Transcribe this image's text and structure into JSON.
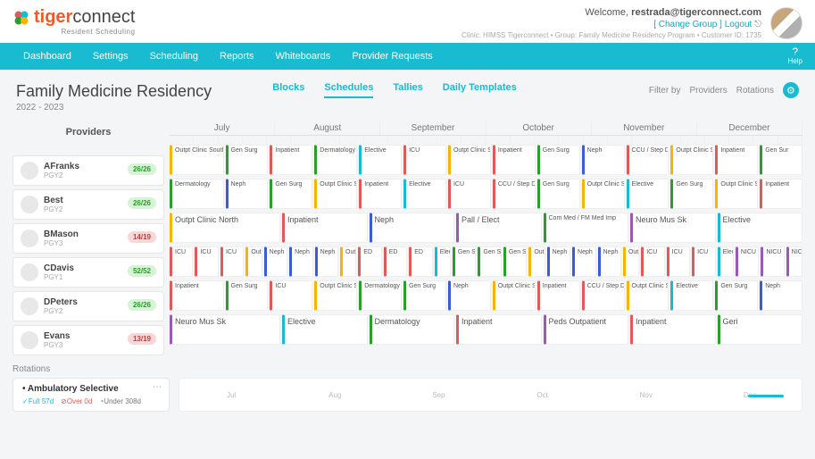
{
  "header": {
    "brand_tiger": "tiger",
    "brand_connect": "connect",
    "brand_sub": "Resident Scheduling",
    "welcome_prefix": "Welcome, ",
    "welcome_user": "restrada@tigerconnect.com",
    "link_change_group": "[ Change Group ]",
    "link_logout": "Logout",
    "meta": "Clinic: HIMSS Tigerconnect • Group: Family Medicine Residency Program • Customer ID: 1735"
  },
  "nav": {
    "items": [
      "Dashboard",
      "Settings",
      "Scheduling",
      "Reports",
      "Whiteboards",
      "Provider Requests"
    ],
    "help": "Help"
  },
  "title": {
    "main": "Family Medicine Residency",
    "sub": "2022 - 2023"
  },
  "tabs": [
    "Blocks",
    "Schedules",
    "Tallies",
    "Daily Templates"
  ],
  "filter": {
    "label": "Filter by",
    "providers": "Providers",
    "rotations": "Rotations"
  },
  "providers_header": "Providers",
  "months": [
    "July",
    "August",
    "September",
    "October",
    "November",
    "December"
  ],
  "providers": [
    {
      "name": "AFranks",
      "level": "PGY2",
      "badge": "26/26",
      "badgeClass": "green",
      "blocks": [
        {
          "w": 4,
          "c": "#f7b500",
          "t": "Outpt Clinic South"
        },
        {
          "w": 3,
          "c": "#2a9d2a",
          "t": "Gen Surg"
        },
        {
          "w": 3,
          "c": "#e05a5a",
          "t": "Inpatient"
        },
        {
          "w": 3,
          "c": "#2a9d2a",
          "t": "Dermatology"
        },
        {
          "w": 3,
          "c": "#18bbcf",
          "t": "Elective"
        },
        {
          "w": 3,
          "c": "#e05a5a",
          "t": "ICU"
        },
        {
          "w": 3,
          "c": "#f7b500",
          "t": "Outpt Clinic South"
        },
        {
          "w": 3,
          "c": "#e05a5a",
          "t": "Inpatient"
        },
        {
          "w": 3,
          "c": "#2a9d2a",
          "t": "Gen Surg"
        },
        {
          "w": 3,
          "c": "#3b5bdb",
          "t": "Neph"
        },
        {
          "w": 3,
          "c": "#e05a5a",
          "t": "CCU / Step Down"
        },
        {
          "w": 3,
          "c": "#f7b500",
          "t": "Outpt Clinic South"
        },
        {
          "w": 3,
          "c": "#e05a5a",
          "t": "Inpatient"
        },
        {
          "w": 3,
          "c": "#2a9d2a",
          "t": "Gen Sur"
        }
      ]
    },
    {
      "name": "Best",
      "level": "PGY2",
      "badge": "26/26",
      "badgeClass": "green",
      "blocks": [
        {
          "w": 4,
          "c": "#2a9d2a",
          "t": "Dermatology"
        },
        {
          "w": 3,
          "c": "#3b5bdb",
          "t": "Neph"
        },
        {
          "w": 3,
          "c": "#2a9d2a",
          "t": "Gen Surg"
        },
        {
          "w": 3,
          "c": "#f7b500",
          "t": "Outpt Clinic South"
        },
        {
          "w": 3,
          "c": "#e05a5a",
          "t": "Inpatient"
        },
        {
          "w": 3,
          "c": "#18bbcf",
          "t": "Elective"
        },
        {
          "w": 3,
          "c": "#e05a5a",
          "t": "ICU"
        },
        {
          "w": 3,
          "c": "#e05a5a",
          "t": "CCU / Step Down"
        },
        {
          "w": 3,
          "c": "#2a9d2a",
          "t": "Gen Surg"
        },
        {
          "w": 3,
          "c": "#f7b500",
          "t": "Outpt Clinic South"
        },
        {
          "w": 3,
          "c": "#18bbcf",
          "t": "Elective"
        },
        {
          "w": 3,
          "c": "#2a9d2a",
          "t": "Gen Surg"
        },
        {
          "w": 3,
          "c": "#f7b500",
          "t": "Outpt Clinic South"
        },
        {
          "w": 3,
          "c": "#e05a5a",
          "t": "Inpatient"
        }
      ]
    },
    {
      "name": "BMason",
      "level": "PGY3",
      "badge": "14/19",
      "badgeClass": "red",
      "blocks": [
        {
          "w": 8,
          "c": "#f7b500",
          "t": "Outpt Clinic North",
          "big": true
        },
        {
          "w": 6,
          "c": "#e05a5a",
          "t": "Inpatient",
          "big": true
        },
        {
          "w": 6,
          "c": "#3b5bdb",
          "t": "Neph",
          "big": true
        },
        {
          "w": 6,
          "c": "#9b59b6",
          "t": "Pall / Elect",
          "big": true
        },
        {
          "w": 6,
          "c": "#2a9d2a",
          "t": "Com Med / FM Med Imp"
        },
        {
          "w": 6,
          "c": "#9b59b6",
          "t": "Neuro Mus Sk",
          "big": true
        },
        {
          "w": 6,
          "c": "#18bbcf",
          "t": "Elective",
          "big": true
        }
      ]
    },
    {
      "name": "CDavis",
      "level": "PGY1",
      "badge": "52/52",
      "badgeClass": "green",
      "blocks": [
        {
          "w": 2,
          "c": "#e05a5a",
          "t": "ICU"
        },
        {
          "w": 2,
          "c": "#e05a5a",
          "t": "ICU"
        },
        {
          "w": 2,
          "c": "#e05a5a",
          "t": "ICU"
        },
        {
          "w": 1,
          "c": "#f7b500",
          "t": "Outpt"
        },
        {
          "w": 2,
          "c": "#3b5bdb",
          "t": "Neph"
        },
        {
          "w": 2,
          "c": "#3b5bdb",
          "t": "Neph"
        },
        {
          "w": 2,
          "c": "#3b5bdb",
          "t": "Neph"
        },
        {
          "w": 1,
          "c": "#f7b500",
          "t": "Outpt"
        },
        {
          "w": 2,
          "c": "#e05a5a",
          "t": "ED"
        },
        {
          "w": 2,
          "c": "#e05a5a",
          "t": "ED"
        },
        {
          "w": 2,
          "c": "#e05a5a",
          "t": "ED"
        },
        {
          "w": 1,
          "c": "#18bbcf",
          "t": "Electiv"
        },
        {
          "w": 2,
          "c": "#2a9d2a",
          "t": "Gen S"
        },
        {
          "w": 2,
          "c": "#2a9d2a",
          "t": "Gen S"
        },
        {
          "w": 2,
          "c": "#2a9d2a",
          "t": "Gen S"
        },
        {
          "w": 1,
          "c": "#f7b500",
          "t": "Outpt"
        },
        {
          "w": 2,
          "c": "#3b5bdb",
          "t": "Neph"
        },
        {
          "w": 2,
          "c": "#3b5bdb",
          "t": "Neph"
        },
        {
          "w": 2,
          "c": "#3b5bdb",
          "t": "Neph"
        },
        {
          "w": 1,
          "c": "#f7b500",
          "t": "Outpt"
        },
        {
          "w": 2,
          "c": "#e05a5a",
          "t": "ICU"
        },
        {
          "w": 2,
          "c": "#e05a5a",
          "t": "ICU"
        },
        {
          "w": 2,
          "c": "#e05a5a",
          "t": "ICU"
        },
        {
          "w": 1,
          "c": "#18bbcf",
          "t": "Electiv"
        },
        {
          "w": 2,
          "c": "#9b59b6",
          "t": "NICU"
        },
        {
          "w": 2,
          "c": "#9b59b6",
          "t": "NICU"
        },
        {
          "w": 1,
          "c": "#9b59b6",
          "t": "NICU"
        }
      ]
    },
    {
      "name": "DPeters",
      "level": "PGY2",
      "badge": "26/26",
      "badgeClass": "green",
      "blocks": [
        {
          "w": 4,
          "c": "#e05a5a",
          "t": "Inpatient"
        },
        {
          "w": 3,
          "c": "#2a9d2a",
          "t": "Gen Surg"
        },
        {
          "w": 3,
          "c": "#e05a5a",
          "t": "ICU"
        },
        {
          "w": 3,
          "c": "#f7b500",
          "t": "Outpt Clinic South"
        },
        {
          "w": 3,
          "c": "#2a9d2a",
          "t": "Dermatology"
        },
        {
          "w": 3,
          "c": "#2a9d2a",
          "t": "Gen Surg"
        },
        {
          "w": 3,
          "c": "#3b5bdb",
          "t": "Neph"
        },
        {
          "w": 3,
          "c": "#f7b500",
          "t": "Outpt Clinic South"
        },
        {
          "w": 3,
          "c": "#e05a5a",
          "t": "Inpatient"
        },
        {
          "w": 3,
          "c": "#e05a5a",
          "t": "CCU / Step Down"
        },
        {
          "w": 3,
          "c": "#f7b500",
          "t": "Outpt Clinic South"
        },
        {
          "w": 3,
          "c": "#18bbcf",
          "t": "Elective"
        },
        {
          "w": 3,
          "c": "#2a9d2a",
          "t": "Gen Surg"
        },
        {
          "w": 3,
          "c": "#3b5bdb",
          "t": "Neph"
        }
      ]
    },
    {
      "name": "Evans",
      "level": "PGY3",
      "badge": "13/19",
      "badgeClass": "red",
      "blocks": [
        {
          "w": 8,
          "c": "#9b59b6",
          "t": "Neuro Mus Sk",
          "big": true
        },
        {
          "w": 6,
          "c": "#18bbcf",
          "t": "Elective",
          "big": true
        },
        {
          "w": 6,
          "c": "#2a9d2a",
          "t": "Dermatology",
          "big": true
        },
        {
          "w": 6,
          "c": "#e05a5a",
          "t": "Inpatient",
          "big": true
        },
        {
          "w": 6,
          "c": "#9b59b6",
          "t": "Peds Outpatient",
          "big": true
        },
        {
          "w": 6,
          "c": "#e05a5a",
          "t": "Inpatient",
          "big": true
        },
        {
          "w": 6,
          "c": "#2a9d2a",
          "t": "Geri",
          "big": true
        }
      ]
    }
  ],
  "rotations": {
    "label": "Rotations",
    "card": {
      "title": "Ambulatory Selective",
      "full": "Full 57d",
      "over": "Over 0d",
      "under": "Under 308d"
    },
    "tl_months": [
      "Jul",
      "Aug",
      "Sep",
      "Oct",
      "Nov",
      "Dec"
    ]
  }
}
